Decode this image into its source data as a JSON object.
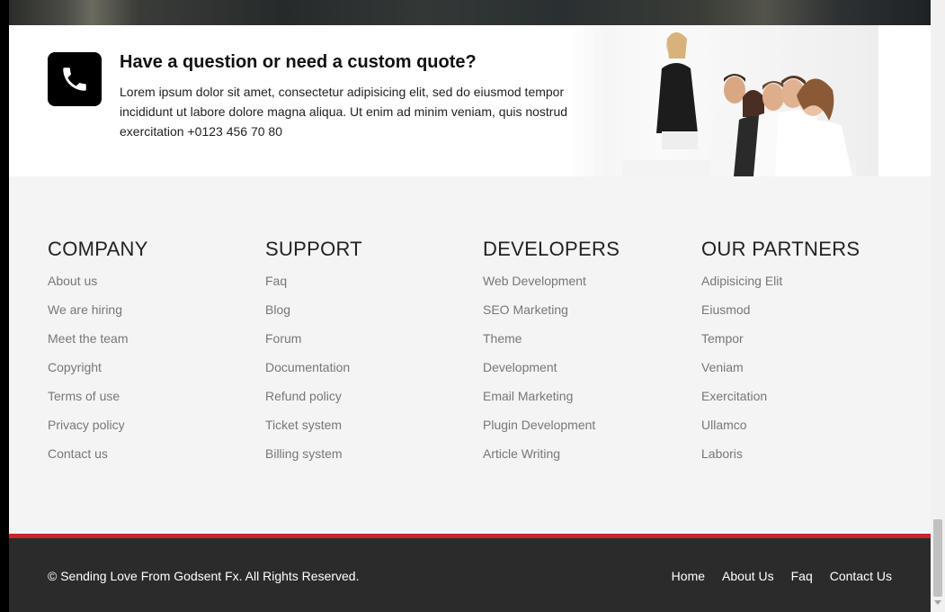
{
  "quote": {
    "title": "Have a question or need a custom quote?",
    "text": "Lorem ipsum dolor sit amet, consectetur adipisicing elit, sed do eiusmod tempor incididunt ut labore dolore magna aliqua. Ut enim ad minim veniam, quis nostrud exercitation +0123 456 70 80",
    "icon": "phone-icon"
  },
  "columns": [
    {
      "heading": "COMPANY",
      "links": [
        "About us",
        "We are hiring",
        "Meet the team",
        "Copyright",
        "Terms of use",
        "Privacy policy",
        "Contact us"
      ]
    },
    {
      "heading": "SUPPORT",
      "links": [
        "Faq",
        "Blog",
        "Forum",
        "Documentation",
        "Refund policy",
        "Ticket system",
        "Billing system"
      ]
    },
    {
      "heading": "DEVELOPERS",
      "links": [
        "Web Development",
        "SEO Marketing",
        "Theme",
        "Development",
        "Email Marketing",
        "Plugin Development",
        "Article Writing"
      ]
    },
    {
      "heading": "OUR PARTNERS",
      "links": [
        "Adipisicing Elit",
        "Eiusmod",
        "Tempor",
        "Veniam",
        "Exercitation",
        "Ullamco",
        "Laboris"
      ]
    }
  ],
  "footer": {
    "copyright": "© Sending Love From Godsent Fx. All Rights Reserved.",
    "nav": [
      "Home",
      "About Us",
      "Faq",
      "Contact Us"
    ]
  },
  "colors": {
    "accent_red": "#c8262a",
    "footer_bg": "#2b2b2b",
    "page_bg": "#f4f4f4"
  }
}
